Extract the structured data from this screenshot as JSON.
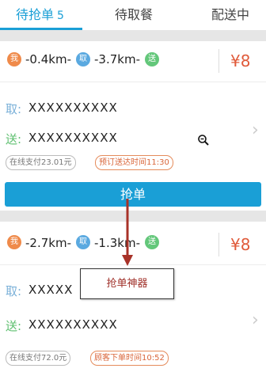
{
  "tabs": [
    {
      "label": "待抢单",
      "count": "5",
      "active": true
    },
    {
      "label": "待取餐",
      "count": "",
      "active": false
    },
    {
      "label": "配送中",
      "count": "",
      "active": false
    }
  ],
  "orders": [
    {
      "me_pin": "我",
      "pick_pin": "取",
      "drop_pin": "送",
      "dist_to_pickup": "-0.4km-",
      "dist_to_drop": "-3.7km-",
      "price": "¥8",
      "pickup_label": "取:",
      "pickup_address": "XXXXXXXXXX",
      "drop_label": "送:",
      "drop_address": "XXXXXXXXXX",
      "payment_tag": "在线支付23.01元",
      "time_tag": "预订送达时间11:30"
    },
    {
      "me_pin": "我",
      "pick_pin": "取",
      "drop_pin": "送",
      "dist_to_pickup": "-2.7km-",
      "dist_to_drop": "-1.3km-",
      "price": "¥8",
      "pickup_label": "取:",
      "pickup_address": "XXXXX",
      "drop_label": "送:",
      "drop_address": "XXXXXXXXXX",
      "payment_tag": "在线支付72.0元",
      "time_tag": "顾客下单时间10:52"
    }
  ],
  "grab_button": "抢单",
  "annotation": {
    "label": "抢单神器"
  },
  "colors": {
    "accent": "#1a9fd6",
    "price": "#e05a3a",
    "annotation_text": "#a0312a"
  }
}
